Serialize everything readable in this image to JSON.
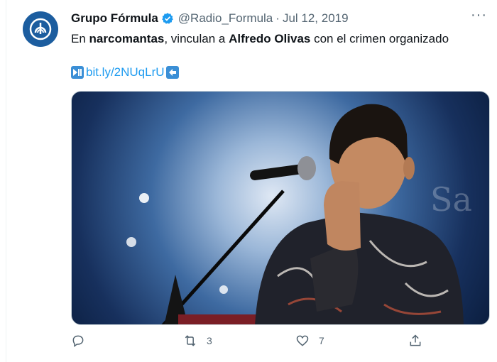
{
  "tweet": {
    "author_name": "Grupo Fórmula",
    "handle": "@Radio_Formula",
    "separator": "·",
    "date": "Jul 12, 2019",
    "more": "···",
    "text_parts": [
      "En ",
      "narcomantas",
      ", vinculan a ",
      "Alfredo Olivas",
      " con el crimen organizado"
    ],
    "link_text": "bit.ly/2NUqLrU",
    "link_prefix_icon": "play-pause-emoji-icon",
    "link_suffix_icon": "left-arrow-emoji-icon",
    "media_description_icon": "concert-photo",
    "actions": {
      "reply_count": "",
      "retweet_count": "3",
      "like_count": "7"
    }
  },
  "colors": {
    "link": "#1d9bf0",
    "muted": "#536471",
    "verified": "#1d9bf0",
    "avatar": "#1c5d9f"
  }
}
